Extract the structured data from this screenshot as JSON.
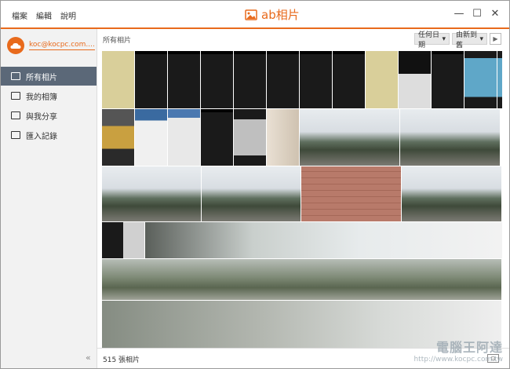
{
  "menu": {
    "file": "檔案",
    "edit": "編輯",
    "help": "說明"
  },
  "app": {
    "title": "ab相片",
    "accent": "#e86a1c"
  },
  "window_controls": {
    "minimize": "—",
    "maximize": "☐",
    "close": "✕"
  },
  "account": {
    "email": "koc@kocpc.com...."
  },
  "sidebar": {
    "items": [
      {
        "label": "所有相片",
        "icon": "photos-icon",
        "active": true
      },
      {
        "label": "我的相簿",
        "icon": "album-icon",
        "active": false
      },
      {
        "label": "與我分享",
        "icon": "shared-icon",
        "active": false
      },
      {
        "label": "匯入記錄",
        "icon": "import-icon",
        "active": false
      }
    ],
    "collapse": "«"
  },
  "toolbar": {
    "breadcrumb": "所有相片",
    "sort_field": "任何日期",
    "sort_order": "由新到舊"
  },
  "status": {
    "count": "515 張相片"
  },
  "watermark": {
    "name": "電腦王阿達",
    "url": "http://www.kocpc.com.tw"
  }
}
